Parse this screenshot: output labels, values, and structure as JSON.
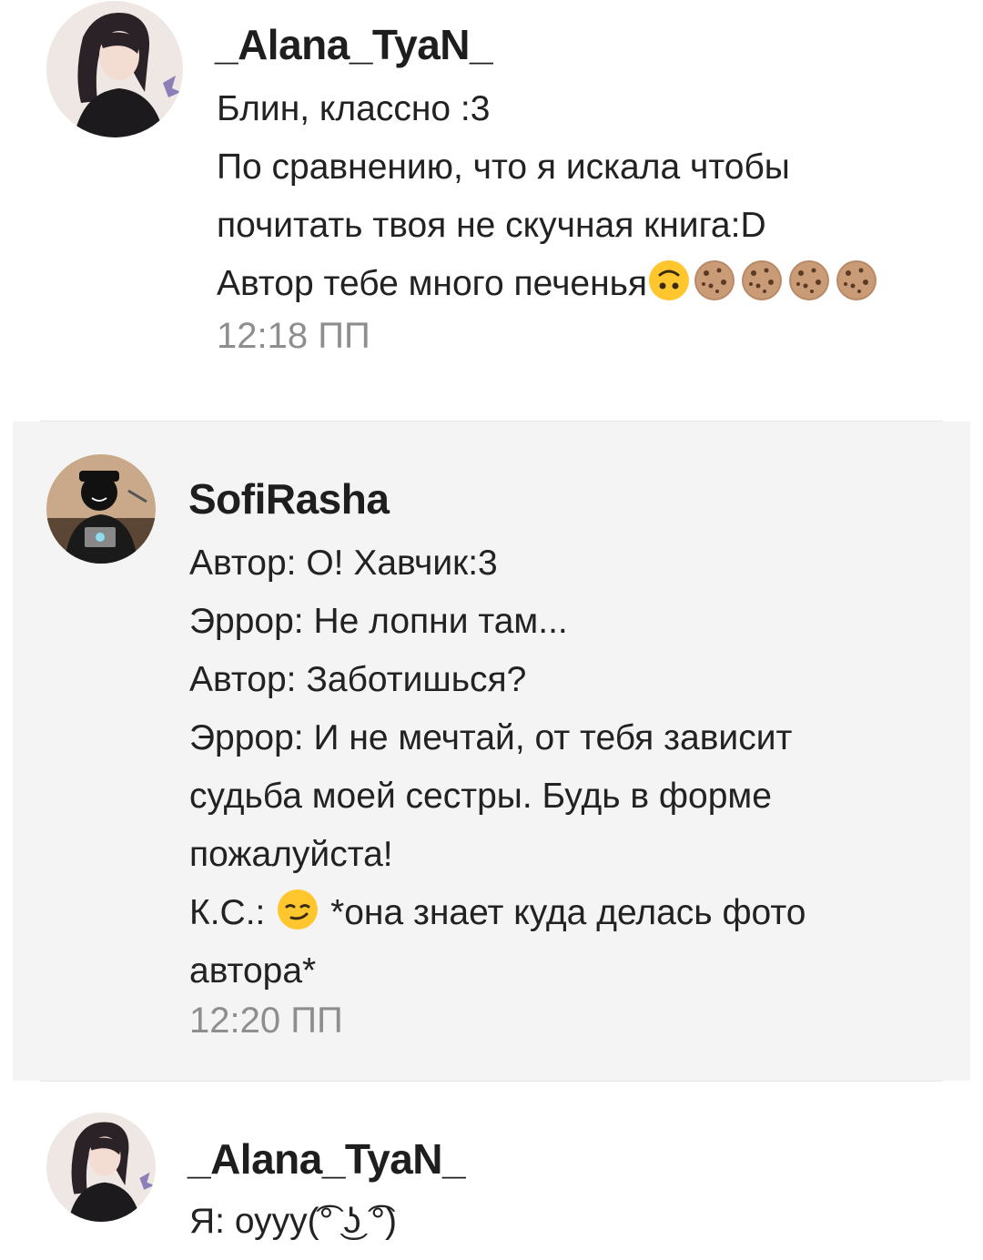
{
  "comments": [
    {
      "username": "_Alana_TyaN_",
      "lines": [
        "Блин, классно :3",
        "По сравнению, что я искала чтобы",
        "почитать твоя не скучная книга:D",
        "Автор тебе много печенья"
      ],
      "emoji_after_last_line": [
        "upside-down-face-icon",
        "cookie-icon",
        "cookie-icon",
        "cookie-icon",
        "cookie-icon"
      ],
      "time": "12:18 ПП"
    },
    {
      "username": "SofiRasha",
      "lines": [
        "Автор: О! Хавчик:3",
        "Эррор: Не лопни там...",
        "Автор: Заботишься?",
        "Эррор: И не мечтай, от тебя зависит",
        "судьба моей сестры. Будь в форме",
        "пожалуйста!"
      ],
      "line_with_emoji": {
        "before": "К.С.: ",
        "emoji": "smirking-face-icon",
        "after": " *она знает куда делась фото"
      },
      "line_after_emoji": "автора*",
      "time": "12:20 ПП"
    },
    {
      "username": "_Alana_TyaN_",
      "lines": [
        "Я: оууу(͡° ͜ʖ ͡°)"
      ]
    }
  ],
  "colors": {
    "background": "#ffffff",
    "highlight_background": "#f4f4f4",
    "text": "#222222",
    "timestamp": "#8e8e8e",
    "divider": "#e6e6e6"
  }
}
